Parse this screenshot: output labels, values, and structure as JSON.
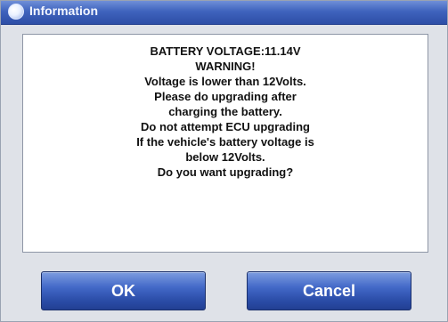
{
  "dialog": {
    "title": "Information",
    "message_lines": [
      "BATTERY VOLTAGE:11.14V",
      "WARNING!",
      "Voltage is lower than 12Volts.",
      "Please do upgrading after",
      "charging the battery.",
      "Do not attempt ECU upgrading",
      "If the vehicle's battery voltage is",
      "below 12Volts.",
      "Do you want upgrading?"
    ],
    "buttons": {
      "ok_label": "OK",
      "cancel_label": "Cancel"
    },
    "icons": {
      "title_icon": "info-icon"
    },
    "colors": {
      "title_bar": "#3f63bd",
      "button": "#2d4ea6",
      "background": "#dfe2e8"
    }
  }
}
